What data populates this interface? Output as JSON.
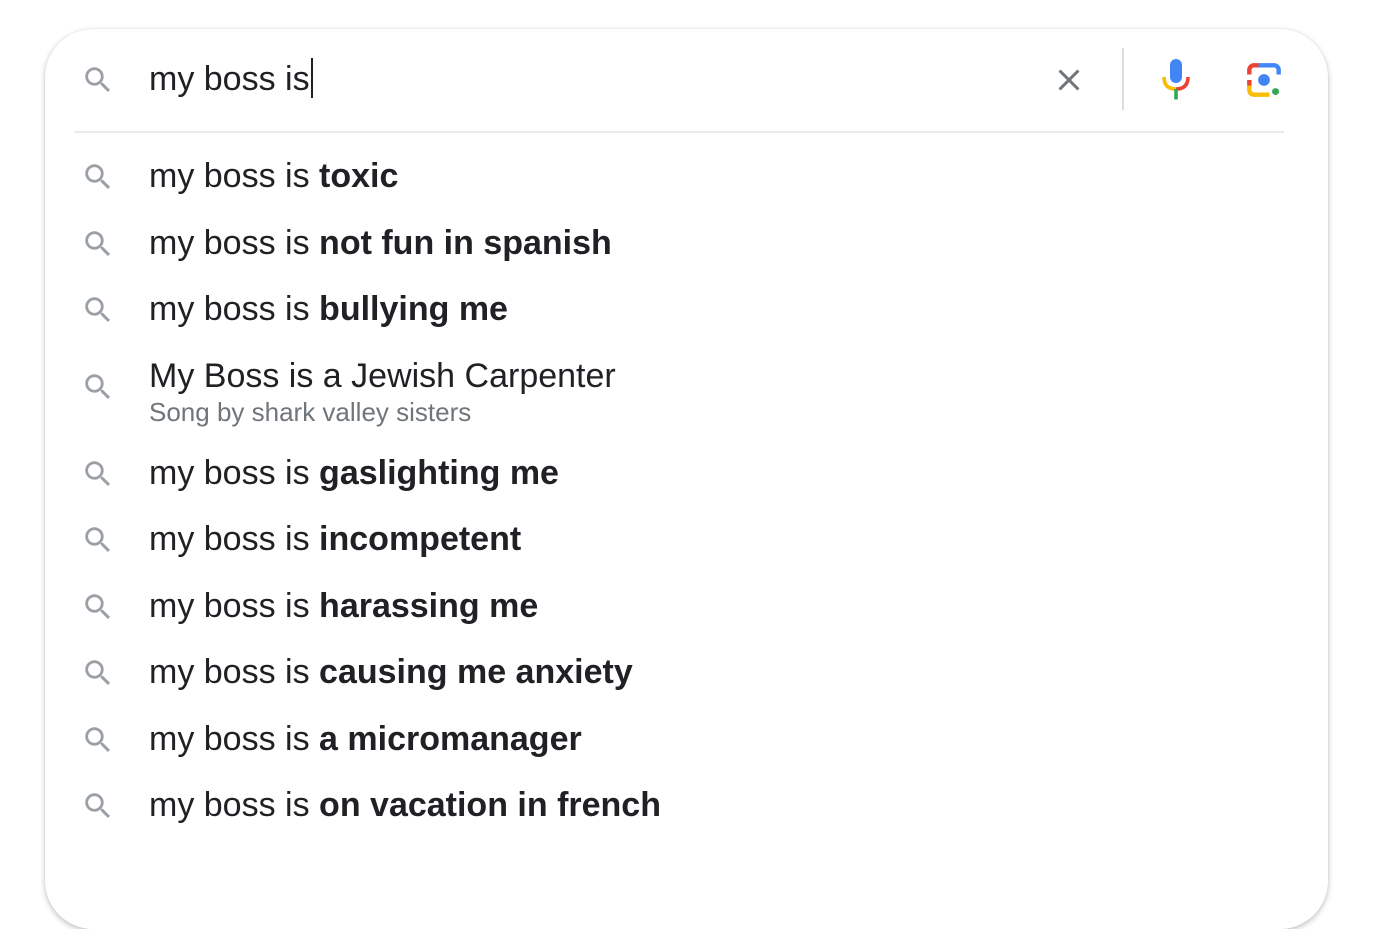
{
  "search": {
    "query": "my boss is",
    "icons": {
      "search": "search-icon",
      "clear": "close-icon",
      "voice": "microphone-icon",
      "lens": "camera-lens-icon"
    }
  },
  "suggestions": [
    {
      "prefix": "my boss is ",
      "completion": "toxic"
    },
    {
      "prefix": "my boss is ",
      "completion": "not fun in spanish"
    },
    {
      "prefix": "my boss is ",
      "completion": "bullying me"
    },
    {
      "title": "My Boss is a Jewish Carpenter",
      "subtitle": "Song by shark valley sisters"
    },
    {
      "prefix": "my boss is ",
      "completion": "gaslighting me"
    },
    {
      "prefix": "my boss is ",
      "completion": "incompetent"
    },
    {
      "prefix": "my boss is ",
      "completion": "harassing me"
    },
    {
      "prefix": "my boss is ",
      "completion": "causing me anxiety"
    },
    {
      "prefix": "my boss is ",
      "completion": "a micromanager"
    },
    {
      "prefix": "my boss is ",
      "completion": "on vacation in french"
    }
  ],
  "colors": {
    "icon_gray": "#9aa0a6",
    "clear_gray": "#70757a",
    "google_blue": "#4285f4",
    "google_red": "#ea4335",
    "google_yellow": "#fbbc04",
    "google_green": "#34a853"
  }
}
